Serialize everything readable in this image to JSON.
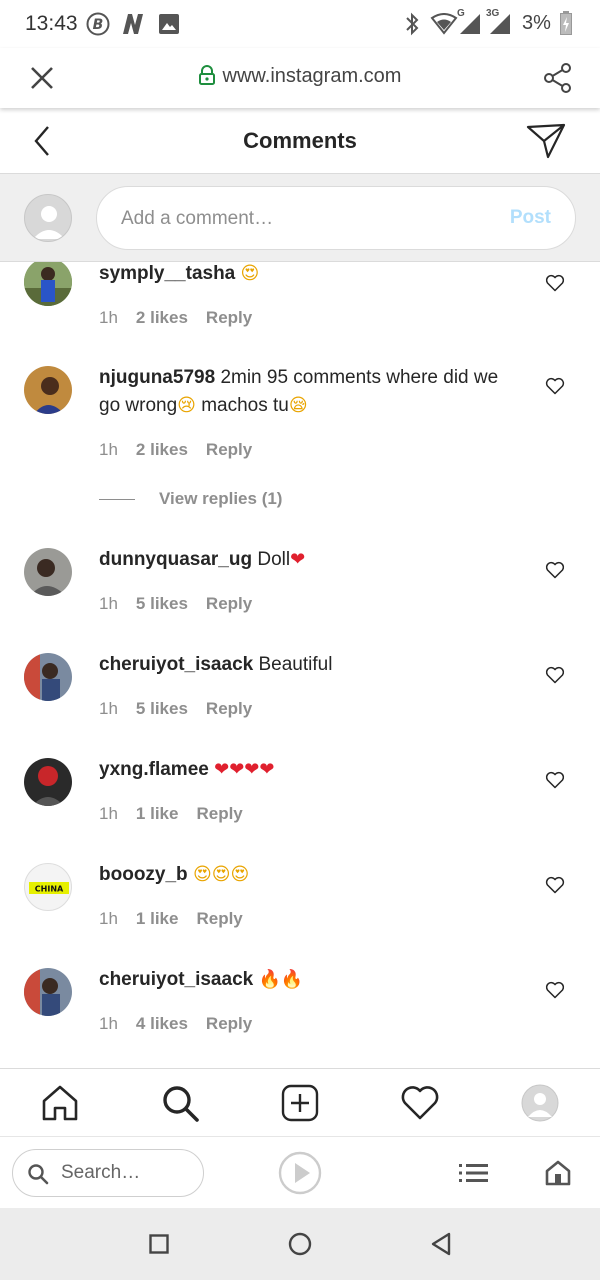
{
  "status_bar": {
    "time": "13:43",
    "network": "3G",
    "network_g": "G",
    "battery": "3%"
  },
  "url_bar": {
    "url": "www.instagram.com"
  },
  "header": {
    "title": "Comments"
  },
  "comment_input": {
    "placeholder": "Add a comment…",
    "post_label": "Post"
  },
  "comments": [
    {
      "username": "symply__tasha",
      "text": "",
      "emojis": [
        {
          "char": "😍",
          "kind": "face"
        }
      ],
      "time": "1h",
      "likes": "2 likes",
      "reply": "Reply"
    },
    {
      "username": "njuguna5798",
      "text": "2min 95 comments where did we go wrong",
      "emojis_mid": [
        {
          "char": "😢",
          "kind": "face"
        }
      ],
      "text2": " machos tu",
      "emojis": [
        {
          "char": "😪",
          "kind": "face"
        }
      ],
      "time": "1h",
      "likes": "2 likes",
      "reply": "Reply",
      "view_replies": "View replies (1)"
    },
    {
      "username": "dunnyquasar_ug",
      "text": "Doll",
      "emojis": [
        {
          "char": "❤",
          "kind": "heart"
        }
      ],
      "time": "1h",
      "likes": "5 likes",
      "reply": "Reply"
    },
    {
      "username": "cheruiyot_isaack",
      "text": "Beautiful",
      "emojis": [],
      "time": "1h",
      "likes": "5 likes",
      "reply": "Reply"
    },
    {
      "username": "yxng.flamee",
      "text": "",
      "emojis": [
        {
          "char": "❤",
          "kind": "heart"
        },
        {
          "char": "❤",
          "kind": "heart"
        },
        {
          "char": "❤",
          "kind": "heart"
        },
        {
          "char": "❤",
          "kind": "heart"
        }
      ],
      "time": "1h",
      "likes": "1 like",
      "reply": "Reply"
    },
    {
      "username": "booozy_b",
      "text": "",
      "emojis": [
        {
          "char": "😍",
          "kind": "face"
        },
        {
          "char": "😍",
          "kind": "face"
        },
        {
          "char": "😍",
          "kind": "face"
        }
      ],
      "time": "1h",
      "likes": "1 like",
      "reply": "Reply",
      "avatar_text": "CHINA"
    },
    {
      "username": "cheruiyot_isaack",
      "text": "",
      "emojis": [
        {
          "char": "🔥",
          "kind": "fire"
        },
        {
          "char": "🔥",
          "kind": "fire"
        }
      ],
      "time": "1h",
      "likes": "4 likes",
      "reply": "Reply"
    }
  ],
  "bottom_tabs": [
    "home-icon",
    "search-icon",
    "new-post-icon",
    "activity-heart-icon",
    "profile-avatar-icon"
  ],
  "browser_bar": {
    "search_placeholder": "Search…"
  },
  "colors": {
    "post_disabled": "#b2dffc",
    "secondary_text": "#8e8e8e",
    "lock_green": "#1e8e3e"
  }
}
